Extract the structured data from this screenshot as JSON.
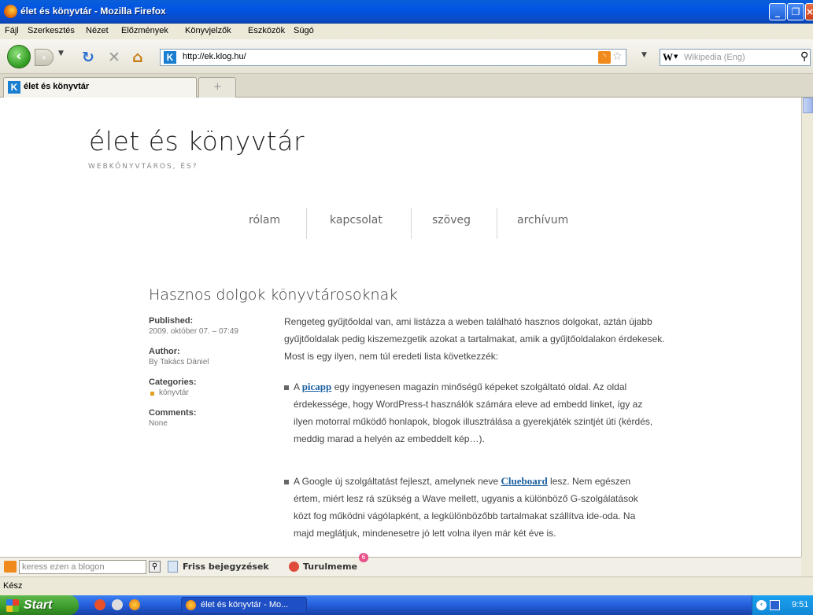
{
  "window": {
    "title": "élet és könyvtár - Mozilla Firefox"
  },
  "menu": [
    "Fájl",
    "Szerkesztés",
    "Nézet",
    "Előzmények",
    "Könyvjelzők",
    "Eszközök",
    "Súgó"
  ],
  "nav": {
    "url": "http://ek.klog.hu/",
    "search_placeholder": "Wikipedia (Eng)",
    "search_engine_letter": "W"
  },
  "tab": {
    "label": "élet és könyvtár",
    "new_tab": "+"
  },
  "site": {
    "title": "élet és könyvtár",
    "tagline": "WEBKÖNYVTÁROS, ÉS?",
    "nav": [
      "rólam",
      "kapcsolat",
      "szöveg",
      "archívum"
    ]
  },
  "post": {
    "title": "Hasznos dolgok könyvtárosoknak",
    "published_label": "Published:",
    "published_value": "2009. október 07. – 07:49",
    "author_label": "Author:",
    "author_value": "By Takács Dániel",
    "categories_label": "Categories:",
    "category": "könyvtár",
    "comments_label": "Comments:",
    "comments_value": "None",
    "intro": "Rengeteg gyűjtőoldal van, ami listázza a weben található hasznos dolgokat, aztán újabb gyűjtőoldalak pedig kiszemezgetik azokat a tartalmakat, amik a gyűjtőoldalakon érdekesek. Most is egy ilyen, nem túl eredeti lista következzék:",
    "item1_pre": "A ",
    "item1_link": "picapp",
    "item1_post": " egy ingyenesen magazin minőségű képeket szolgáltató oldal. Az oldal érdekessége, hogy WordPress-t használók számára eleve ad embedd linket, így az ilyen motorral működő honlapok, blogok illusztrálása a gyerekjáték szintjét üti (kérdés, meddig marad a helyén az embeddelt kép…).",
    "item2_pre": "A Google új szolgáltatást fejleszt, amelynek neve ",
    "item2_link": "Clueboard",
    "item2_post": " lesz. Nem egészen értem, miért lesz rá szükség a Wave mellett, ugyanis a különböző G-szolgálatások közt fog működni vágólapként, a legkülönbözőbb tartalmakat szállítva ide-oda. Na majd meglátjuk, mindenesetre jó lett volna ilyen már két éve is."
  },
  "blogbar": {
    "search_placeholder": "keress ezen a blogon",
    "recent": "Friss bejegyzések",
    "turul": "Turulmeme",
    "badge": "6"
  },
  "status": "Kész",
  "taskbar": {
    "start": "Start",
    "task": "élet és könyvtár - Mo...",
    "clock": "9:51"
  },
  "colors": {
    "link": "#1a5fa0",
    "titlebar": "#0054e3",
    "taskbar": "#245edb"
  }
}
